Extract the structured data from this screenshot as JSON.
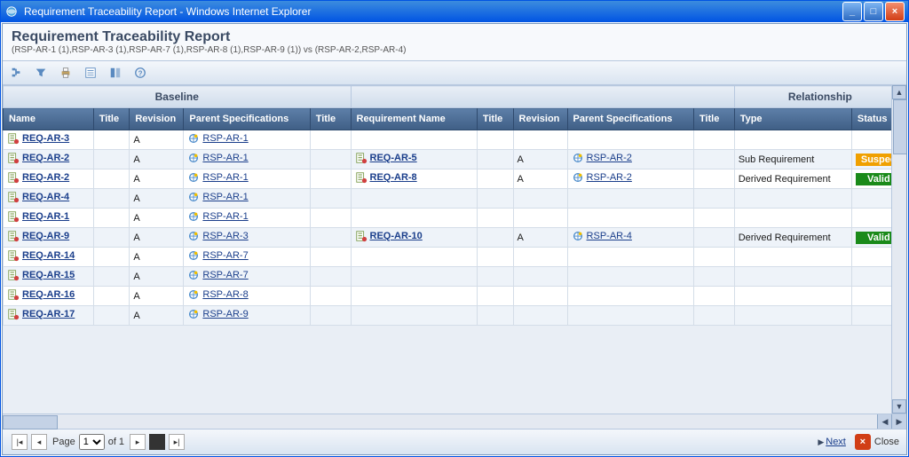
{
  "window": {
    "title": "Requirement Traceability Report - Windows Internet Explorer"
  },
  "header": {
    "title": "Requirement Traceability Report",
    "subtitle": "(RSP-AR-1 (1),RSP-AR-3 (1),RSP-AR-7 (1),RSP-AR-8 (1),RSP-AR-9 (1)) vs (RSP-AR-2,RSP-AR-4)"
  },
  "toolbar": {
    "icons": [
      "tree-icon",
      "filter-icon",
      "print-icon",
      "export-icon",
      "columns-icon",
      "help-icon"
    ]
  },
  "groups": {
    "baseline": "Baseline",
    "right": "",
    "relationship": "Relationship"
  },
  "columns": {
    "b_name": "Name",
    "b_title": "Title",
    "b_rev": "Revision",
    "b_parent": "Parent Specifications",
    "b_ptitle": "Title",
    "r_name": "Requirement Name",
    "r_title": "Title",
    "r_rev": "Revision",
    "r_parent": "Parent Specifications",
    "r_ptitle": "Title",
    "rel_type": "Type",
    "rel_status": "Status"
  },
  "rows": [
    {
      "b_name": "REQ-AR-3",
      "b_rev": "A",
      "b_parent": "RSP-AR-1",
      "r_name": "",
      "r_rev": "",
      "r_parent": "",
      "rel_type": "",
      "rel_status": ""
    },
    {
      "b_name": "REQ-AR-2",
      "b_rev": "A",
      "b_parent": "RSP-AR-1",
      "r_name": "REQ-AR-5",
      "r_rev": "A",
      "r_parent": "RSP-AR-2",
      "rel_type": "Sub Requirement",
      "rel_status": "Suspect"
    },
    {
      "b_name": "REQ-AR-2",
      "b_rev": "A",
      "b_parent": "RSP-AR-1",
      "r_name": "REQ-AR-8",
      "r_rev": "A",
      "r_parent": "RSP-AR-2",
      "rel_type": "Derived Requirement",
      "rel_status": "Valid"
    },
    {
      "b_name": "REQ-AR-4",
      "b_rev": "A",
      "b_parent": "RSP-AR-1",
      "r_name": "",
      "r_rev": "",
      "r_parent": "",
      "rel_type": "",
      "rel_status": ""
    },
    {
      "b_name": "REQ-AR-1",
      "b_rev": "A",
      "b_parent": "RSP-AR-1",
      "r_name": "",
      "r_rev": "",
      "r_parent": "",
      "rel_type": "",
      "rel_status": ""
    },
    {
      "b_name": "REQ-AR-9",
      "b_rev": "A",
      "b_parent": "RSP-AR-3",
      "r_name": "REQ-AR-10",
      "r_rev": "A",
      "r_parent": "RSP-AR-4",
      "rel_type": "Derived Requirement",
      "rel_status": "Valid"
    },
    {
      "b_name": "REQ-AR-14",
      "b_rev": "A",
      "b_parent": "RSP-AR-7",
      "r_name": "",
      "r_rev": "",
      "r_parent": "",
      "rel_type": "",
      "rel_status": ""
    },
    {
      "b_name": "REQ-AR-15",
      "b_rev": "A",
      "b_parent": "RSP-AR-7",
      "r_name": "",
      "r_rev": "",
      "r_parent": "",
      "rel_type": "",
      "rel_status": ""
    },
    {
      "b_name": "REQ-AR-16",
      "b_rev": "A",
      "b_parent": "RSP-AR-8",
      "r_name": "",
      "r_rev": "",
      "r_parent": "",
      "rel_type": "",
      "rel_status": ""
    },
    {
      "b_name": "REQ-AR-17",
      "b_rev": "A",
      "b_parent": "RSP-AR-9",
      "r_name": "",
      "r_rev": "",
      "r_parent": "",
      "rel_type": "",
      "rel_status": ""
    }
  ],
  "status_colors": {
    "Valid": "valid",
    "Suspect": "suspect"
  },
  "footer": {
    "page_label": "Page",
    "of_label": "of 1",
    "page_value": "1",
    "next_label": "Next",
    "close_label": "Close"
  }
}
